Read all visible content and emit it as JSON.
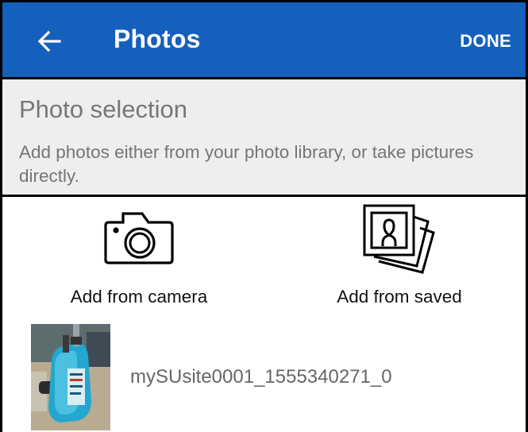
{
  "appbar": {
    "title": "Photos",
    "done_label": "DONE",
    "back_icon": "arrow-left-icon",
    "color": "#1560bd"
  },
  "info": {
    "title": "Photo selection",
    "description": "Add photos either from your photo library, or take pictures directly."
  },
  "actions": [
    {
      "label": "Add from camera",
      "icon": "camera-icon"
    },
    {
      "label": "Add from saved",
      "icon": "photo-stack-icon"
    }
  ],
  "photos": [
    {
      "name": "mySUsite0001_1555340271_0"
    }
  ]
}
